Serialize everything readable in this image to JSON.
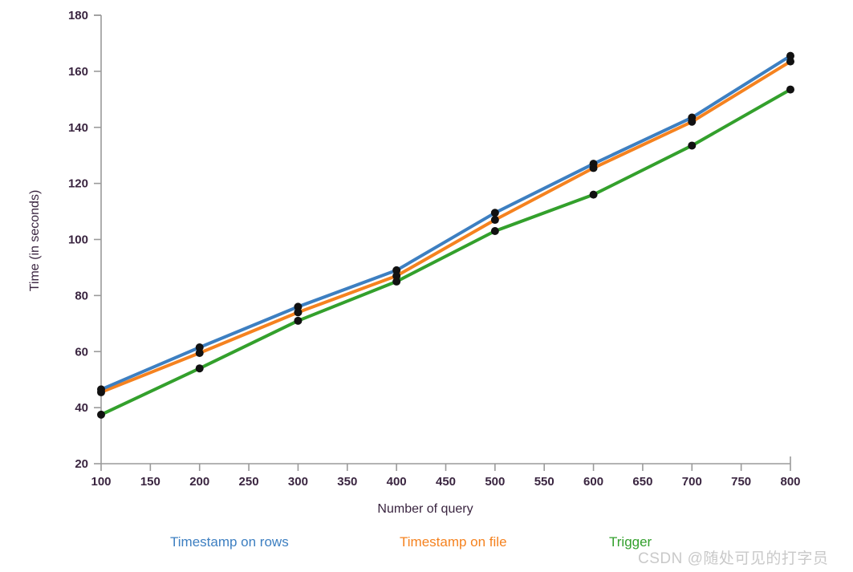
{
  "chart_data": {
    "type": "line",
    "title": "",
    "xlabel": "Number of query",
    "ylabel": "Time (in seconds)",
    "x": [
      100,
      200,
      300,
      400,
      500,
      600,
      700,
      800
    ],
    "xlim": [
      100,
      800
    ],
    "ylim": [
      20,
      180
    ],
    "xticks": [
      "100",
      "150",
      "200",
      "250",
      "300",
      "350",
      "400",
      "450",
      "500",
      "550",
      "600",
      "650",
      "700",
      "750",
      "800"
    ],
    "xtick_values": [
      100,
      150,
      200,
      250,
      300,
      350,
      400,
      450,
      500,
      550,
      600,
      650,
      700,
      750,
      800
    ],
    "yticks": [
      "20",
      "40",
      "60",
      "80",
      "100",
      "120",
      "140",
      "160",
      "180"
    ],
    "ytick_values": [
      20,
      40,
      60,
      80,
      100,
      120,
      140,
      160,
      180
    ],
    "grid": false,
    "legend_position": "bottom",
    "markers": "filled-circle-black",
    "series": [
      {
        "name": "Timestamp on rows",
        "color": "#3d7fc1",
        "values": [
          46.5,
          61.5,
          76.0,
          89.0,
          109.5,
          127.0,
          143.5,
          165.5
        ]
      },
      {
        "name": "Timestamp on file",
        "color": "#f5821f",
        "values": [
          45.5,
          59.5,
          74.0,
          87.0,
          107.0,
          125.5,
          142.0,
          163.5
        ]
      },
      {
        "name": "Trigger",
        "color": "#33a02c",
        "values": [
          37.5,
          54.0,
          71.0,
          85.0,
          103.0,
          116.0,
          133.5,
          153.5
        ]
      }
    ]
  },
  "axis": {
    "x_title": "Number of query",
    "y_title": "Time (in seconds)",
    "label_color": "#3a2540",
    "line_color": "#9a9a9a"
  },
  "legend": {
    "items": [
      {
        "label": "Timestamp on rows",
        "color": "#3d7fc1"
      },
      {
        "label": "Timestamp on file",
        "color": "#f5821f"
      },
      {
        "label": "Trigger",
        "color": "#33a02c"
      }
    ]
  },
  "watermark": {
    "text": "CSDN @随处可见的打字员",
    "color": "#c9c9c9"
  }
}
